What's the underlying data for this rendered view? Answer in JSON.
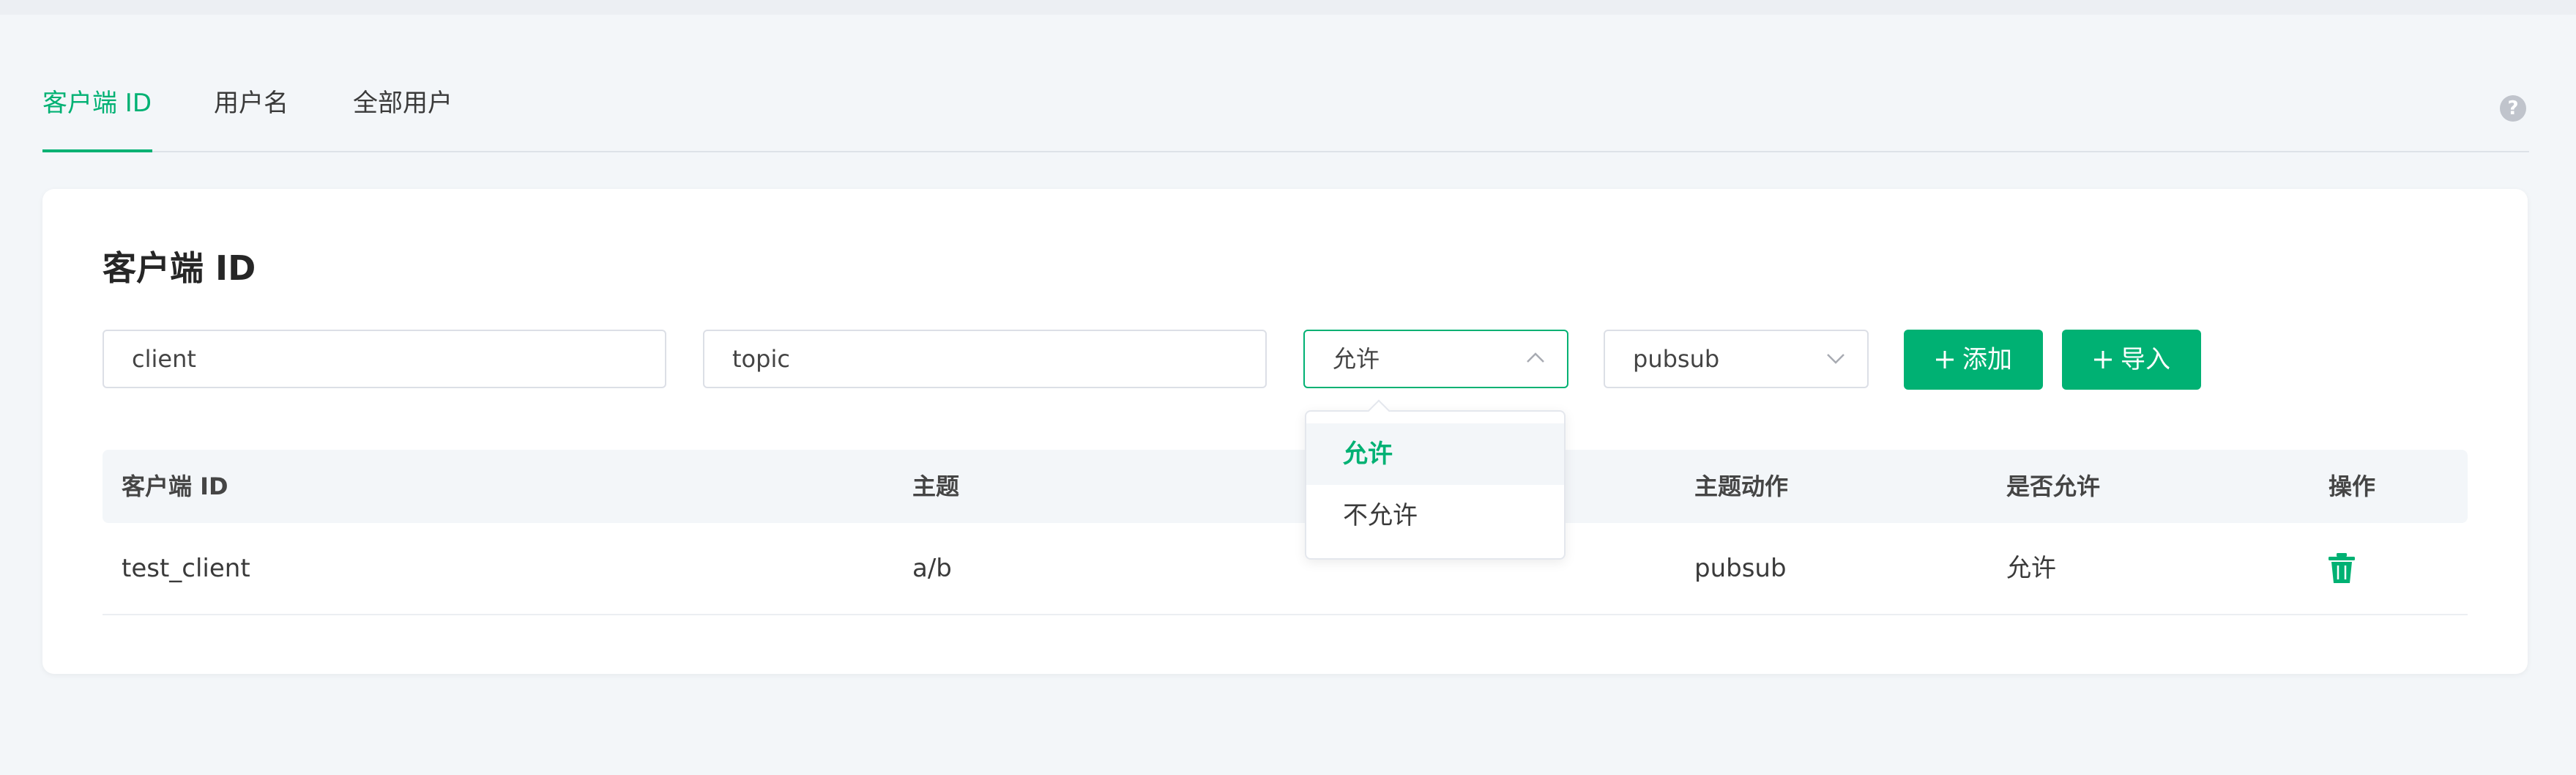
{
  "tabs": [
    {
      "label": "客户端 ID",
      "active": true
    },
    {
      "label": "用户名",
      "active": false
    },
    {
      "label": "全部用户",
      "active": false
    }
  ],
  "help_icon": "question-icon",
  "card": {
    "title": "客户端 ID",
    "form": {
      "client_value": "client",
      "topic_value": "topic",
      "permission_selected": "允许",
      "action_selected": "pubsub",
      "add_label": "添加",
      "import_label": "导入"
    },
    "table": {
      "columns": [
        "客户端 ID",
        "主题",
        "主题动作",
        "是否允许",
        "操作"
      ],
      "rows": [
        {
          "client_id": "test_client",
          "topic": "a/b",
          "action": "pubsub",
          "allow": "允许",
          "op_icon": "trash-icon"
        }
      ]
    }
  },
  "dropdown": {
    "options": [
      "允许",
      "不允许"
    ],
    "selected": "允许"
  },
  "colors": {
    "accent": "#00b173",
    "background": "#f3f6f9"
  }
}
